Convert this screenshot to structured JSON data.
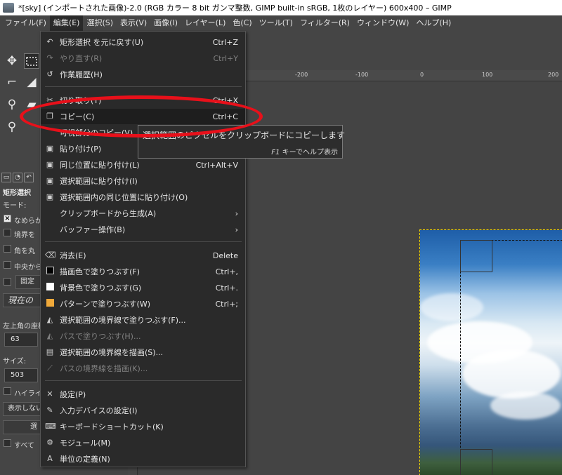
{
  "window": {
    "title": "*[sky] (インポートされた画像)-2.0 (RGB カラー 8 bit ガンマ整数, GIMP built-in sRGB, 1枚のレイヤー) 600x400 – GIMP"
  },
  "menubar": [
    "ファイル(F)",
    "編集(E)",
    "選択(S)",
    "表示(V)",
    "画像(I)",
    "レイヤー(L)",
    "色(C)",
    "ツール(T)",
    "フィルター(R)",
    "ウィンドウ(W)",
    "ヘルプ(H)"
  ],
  "edit_menu": {
    "undo": {
      "label": "矩形選択 を元に戻す(U)",
      "shortcut": "Ctrl+Z"
    },
    "redo": {
      "label": "やり直す(R)",
      "shortcut": "Ctrl+Y"
    },
    "history": {
      "label": "作業履歴(H)"
    },
    "cut": {
      "label": "切り取り(T)",
      "shortcut": "Ctrl+X"
    },
    "copy": {
      "label": "コピー(C)",
      "shortcut": "Ctrl+C"
    },
    "copy_visible": {
      "label": "可視部分のコピー(V)"
    },
    "paste": {
      "label": "貼り付け(P)"
    },
    "paste_in_place": {
      "label": "同じ位置に貼り付け(L)",
      "shortcut": "Ctrl+Alt+V"
    },
    "paste_into": {
      "label": "選択範囲に貼り付け(I)"
    },
    "paste_into_in_place": {
      "label": "選択範囲内の同じ位置に貼り付け(O)"
    },
    "paste_as": {
      "label": "クリップボードから生成(A)"
    },
    "buffer": {
      "label": "バッファー操作(B)"
    },
    "clear": {
      "label": "消去(E)",
      "shortcut": "Delete"
    },
    "fill_fg": {
      "label": "描画色で塗りつぶす(F)",
      "shortcut": "Ctrl+,"
    },
    "fill_bg": {
      "label": "背景色で塗りつぶす(G)",
      "shortcut": "Ctrl+."
    },
    "fill_pattern": {
      "label": "パターンで塗りつぶす(W)",
      "shortcut": "Ctrl+;"
    },
    "fill_selection": {
      "label": "選択範囲の境界線で塗りつぶす(F)..."
    },
    "fill_path": {
      "label": "パスで塗りつぶす(H)..."
    },
    "stroke_selection": {
      "label": "選択範囲の境界線を描画(S)..."
    },
    "stroke_path": {
      "label": "パスの境界線を描画(K)..."
    },
    "preferences": {
      "label": "設定(P)"
    },
    "input_devices": {
      "label": "入力デバイスの設定(I)"
    },
    "shortcuts": {
      "label": "キーボードショートカット(K)"
    },
    "modules": {
      "label": "モジュール(M)"
    },
    "units": {
      "label": "単位の定義(N)"
    }
  },
  "tooltip": {
    "text": "選択範囲のピクセルをクリップボードにコピーします",
    "help_key": "F1",
    "help_text": "キーでヘルプ表示"
  },
  "tool_options": {
    "title": "矩形選択",
    "mode_label": "モード:",
    "antialias": "なめらか",
    "feather": "境界を",
    "rounded": "角を丸",
    "expand": "中央から",
    "fixed": "固定",
    "current": "現在の",
    "position_label": "左上角の座標",
    "position_value": "63",
    "size_label": "サイズ:",
    "size_value": "503",
    "highlight": "ハイライ",
    "guides": "表示しない",
    "auto_shrink": "選",
    "shrink_merged": "すべて"
  },
  "ruler": {
    "ticks": [
      "-200",
      "-100",
      "0",
      "100",
      "200"
    ]
  },
  "colors": {
    "menu_bg": "#2a2a2a",
    "fg_swatch": "#000000",
    "bg_swatch": "#ffffff",
    "pattern_swatch": "#f0a93a",
    "annotation": "#e8101a"
  }
}
